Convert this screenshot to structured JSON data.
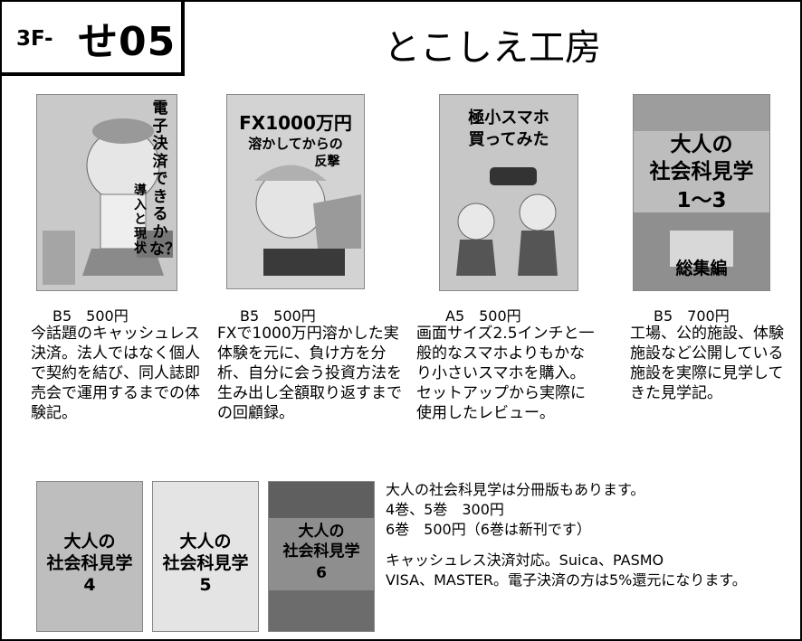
{
  "booth": {
    "prefix": "3F-",
    "code": "せ05"
  },
  "circle_name": "とこしえ工房",
  "books": [
    {
      "cover_title": [
        "電子決済できるかな？",
        "導入と現状"
      ],
      "price": "B5　500円",
      "description": "今話題のキャッシュレス決済。法人ではなく個人で契約を結び、同人誌即売会で運用するまでの体験記。"
    },
    {
      "cover_title": [
        "FX1000万円",
        "溶かしてからの",
        "反撃"
      ],
      "price": "B5　500円",
      "description": "FXで1000万円溶かした実体験を元に、負け方を分析、自分に会う投資方法を生み出し全額取り返すまでの回顧録。"
    },
    {
      "cover_title": [
        "極小スマホ",
        "買ってみた"
      ],
      "price": "A5　500円",
      "description": "画面サイズ2.5インチと一般的なスマホよりもかなり小さいスマホを購入。セットアップから実際に使用したレビュー。"
    },
    {
      "cover_title": [
        "大人の",
        "社会科見学",
        "1～3",
        "総集編"
      ],
      "price": "B5　700円",
      "description": "工場、公的施設、体験施設など公開している施設を実際に見学してきた見学記。"
    }
  ],
  "volumes": [
    {
      "title": [
        "大人の",
        "社会科見学",
        "4"
      ]
    },
    {
      "title": [
        "大人の",
        "社会科見学",
        "5"
      ]
    },
    {
      "title": [
        "大人の",
        "社会科見学",
        "6"
      ]
    }
  ],
  "notes": {
    "separate": "大人の社会科見学は分冊版もあります。",
    "vol45": "4巻、5巻　300円",
    "vol6": "6巻　500円（6巻は新刊です）",
    "payment_1": "キャッシュレス決済対応。Suica、PASMO",
    "payment_2": "VISA、MASTER。電子決済の方は5%還元になります。"
  }
}
